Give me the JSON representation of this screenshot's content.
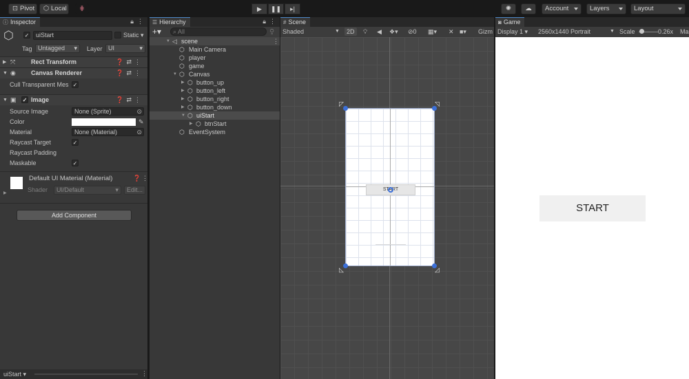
{
  "toolbar": {
    "pivot_label": "Pivot",
    "local_label": "Local",
    "account_label": "Account",
    "layers_label": "Layers",
    "layout_label": "Layout"
  },
  "inspector": {
    "tab_label": "Inspector",
    "object_name": "uiStart",
    "static_label": "Static",
    "tag_label": "Tag",
    "tag_value": "Untagged",
    "layer_label": "Layer",
    "layer_value": "UI",
    "rect_transform_title": "Rect Transform",
    "canvas_renderer_title": "Canvas Renderer",
    "cull_label": "Cull Transparent Mes",
    "image_title": "Image",
    "source_image_label": "Source Image",
    "source_image_value": "None (Sprite)",
    "color_label": "Color",
    "material_label": "Material",
    "material_value": "None (Material)",
    "raycast_target_label": "Raycast Target",
    "raycast_padding_label": "Raycast Padding",
    "maskable_label": "Maskable",
    "default_material_title": "Default UI Material (Material)",
    "shader_label": "Shader",
    "shader_value": "UI/Default",
    "edit_label": "Edit...",
    "add_component_label": "Add Component",
    "footer_label": "uiStart"
  },
  "hierarchy": {
    "tab_label": "Hierarchy",
    "search_placeholder": "All",
    "scene_name": "scene",
    "items": [
      {
        "name": "Main Camera"
      },
      {
        "name": "player"
      },
      {
        "name": "game"
      },
      {
        "name": "Canvas"
      },
      {
        "name": "button_up"
      },
      {
        "name": "button_left"
      },
      {
        "name": "button_right"
      },
      {
        "name": "button_down"
      },
      {
        "name": "uiStart"
      },
      {
        "name": "btnStart"
      },
      {
        "name": "EventSystem"
      }
    ]
  },
  "scene": {
    "tab_label": "Scene",
    "shading_mode": "Shaded",
    "mode_2d": "2D",
    "hidden_count": "0",
    "gizmos_label": "Gizm",
    "button_text": "START"
  },
  "game": {
    "tab_label": "Game",
    "display_label": "Display 1",
    "resolution_label": "2560x1440 Portrait",
    "scale_label": "Scale",
    "scale_value": "0.26x",
    "overflow_label": "Ma",
    "button_text": "START"
  },
  "colors": {
    "selection_blue": "#2c5d87",
    "tab_accent": "#4d88c9",
    "panel_bg": "#383838",
    "scene_bg": "#474747",
    "game_bg": "#ffffff",
    "button_bg": "#f0f0f0"
  }
}
